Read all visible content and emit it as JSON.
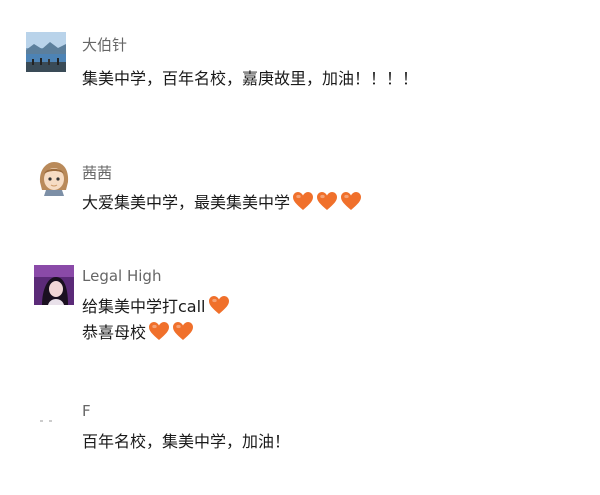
{
  "comments": [
    {
      "name": "大伯针",
      "avatar": "lakeside-photo-avatar",
      "lines": [
        {
          "text": "集美中学，百年名校，嘉庚故里，加油！！！！",
          "hearts": 0
        }
      ]
    },
    {
      "name": "茜茜",
      "avatar": "cartoon-girl-avatar",
      "lines": [
        {
          "text": "大爱集美中学，最美集美中学",
          "hearts": 3
        }
      ]
    },
    {
      "name": "Legal High",
      "avatar": "purple-portrait-avatar",
      "lines": [
        {
          "text": "给集美中学打call",
          "hearts": 1
        },
        {
          "text": "恭喜母校",
          "hearts": 2
        }
      ]
    },
    {
      "name": "F",
      "avatar": "blank-avatar",
      "lines": [
        {
          "text": "百年名校，集美中学，加油！",
          "hearts": 0
        }
      ]
    }
  ],
  "colors": {
    "heart": "#f0702b",
    "name_text": "#666666",
    "body_text": "#1a1a1a"
  },
  "icons": {
    "heart": "heart-icon"
  }
}
